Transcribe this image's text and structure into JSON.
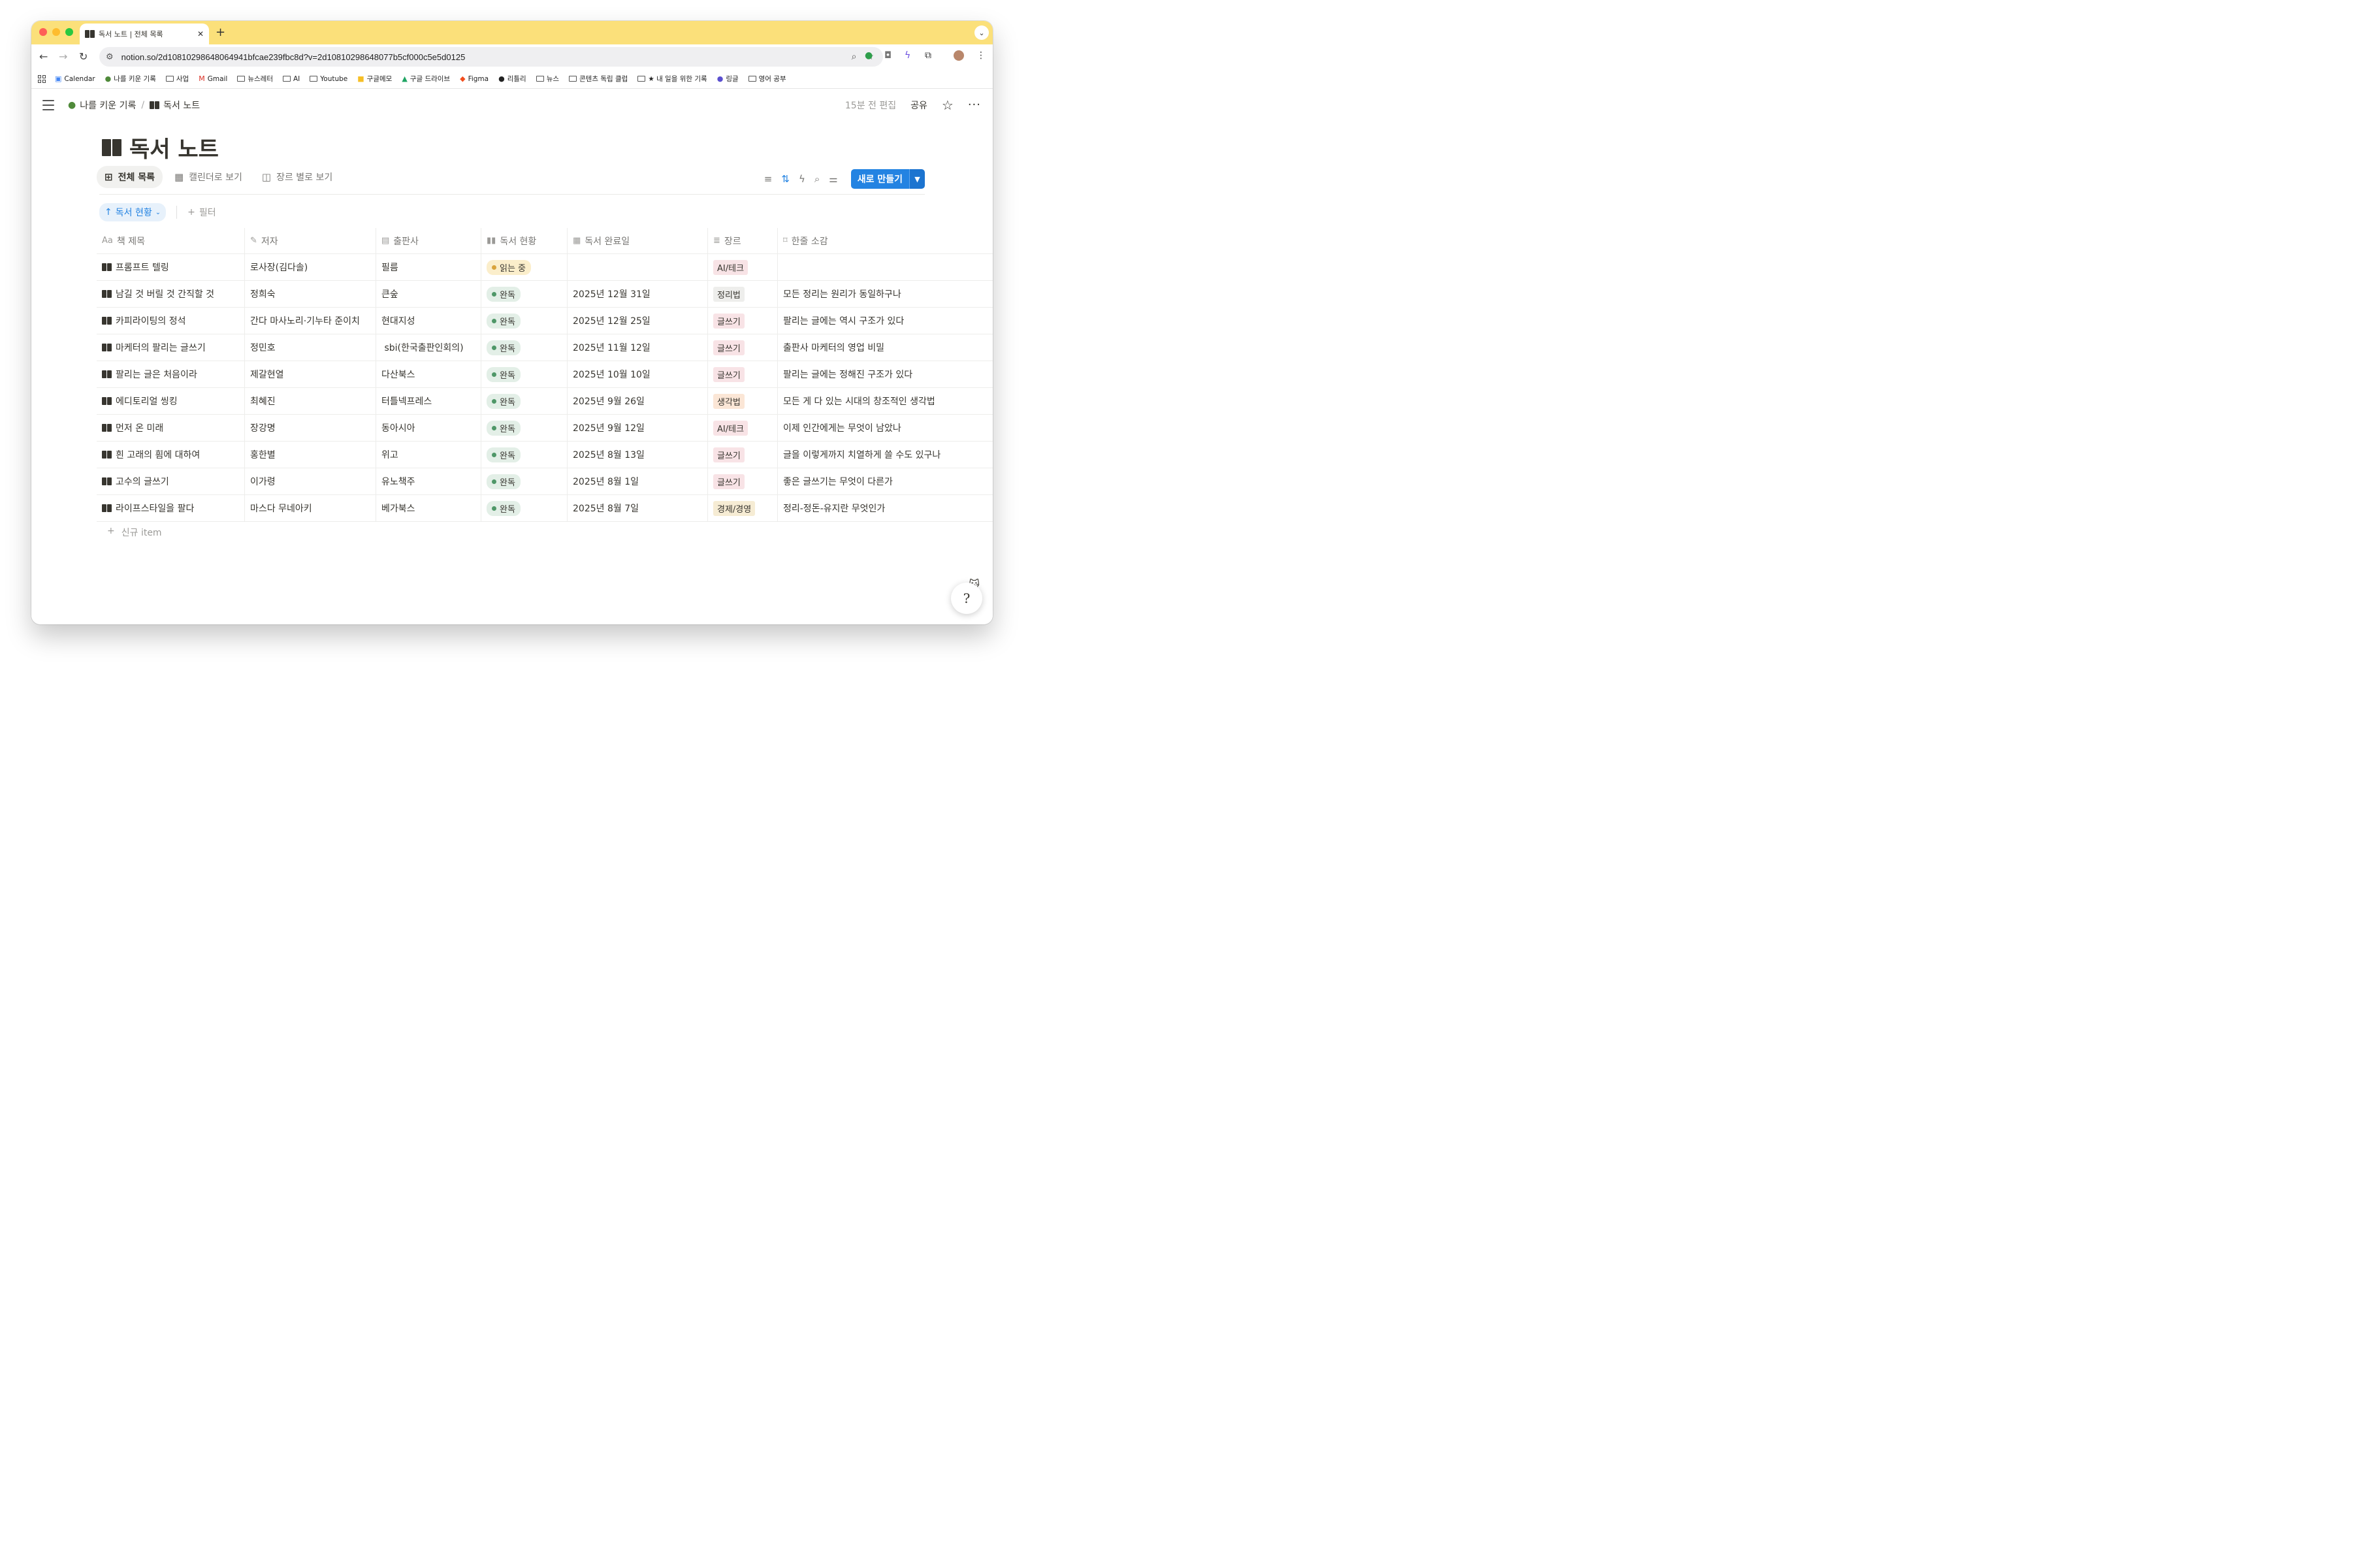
{
  "browser": {
    "tab_title": "독서 노트 | 전체 목록",
    "url": "notion.so/2d10810298648064941bfcae239fbc8d?v=2d10810298648077b5cf000c5e5d0125",
    "bookmarks": [
      {
        "label": "Calendar",
        "icon": "calendar-icon"
      },
      {
        "label": "나를 키운 기록",
        "icon": "tree-icon"
      },
      {
        "label": "사업",
        "icon": "folder-icon"
      },
      {
        "label": "Gmail",
        "icon": "gmail-icon"
      },
      {
        "label": "뉴스레터",
        "icon": "folder-icon"
      },
      {
        "label": "AI",
        "icon": "folder-icon"
      },
      {
        "label": "Youtube",
        "icon": "folder-icon"
      },
      {
        "label": "구글메모",
        "icon": "keep-icon"
      },
      {
        "label": "구글 드라이브",
        "icon": "drive-icon"
      },
      {
        "label": "Figma",
        "icon": "figma-icon"
      },
      {
        "label": "리틀리",
        "icon": "littly-icon"
      },
      {
        "label": "뉴스",
        "icon": "folder-icon"
      },
      {
        "label": "콘텐츠 독립 클럽",
        "icon": "folder-icon"
      },
      {
        "label": "★ 내 일을 위한 기록",
        "icon": "folder-icon"
      },
      {
        "label": "링글",
        "icon": "ringle-icon"
      },
      {
        "label": "영어 공부",
        "icon": "folder-icon"
      }
    ]
  },
  "page": {
    "breadcrumb_parent": "나를 키운 기록",
    "breadcrumb_current": "독서 노트",
    "edited": "15분 전 편집",
    "share": "공유",
    "title": "독서 노트",
    "views": [
      {
        "label": "전체 목록",
        "icon": "table-icon",
        "active": true
      },
      {
        "label": "캘린더로 보기",
        "icon": "calendar-icon",
        "active": false
      },
      {
        "label": "장르 별로 보기",
        "icon": "board-icon",
        "active": false
      }
    ],
    "new_button": "새로 만들기",
    "sort_chip": "독서 현황",
    "add_filter": "필터",
    "new_item": "신규 item"
  },
  "columns": [
    {
      "label": "책 제목",
      "icon": "Aa"
    },
    {
      "label": "저자",
      "icon": "✎"
    },
    {
      "label": "출판사",
      "icon": "▤"
    },
    {
      "label": "독서 현황",
      "icon": "▮▮"
    },
    {
      "label": "독서 완료일",
      "icon": "▦"
    },
    {
      "label": "장르",
      "icon": "≣"
    },
    {
      "label": "한줄 소감",
      "icon": "⌑"
    }
  ],
  "status_styles": {
    "읽는 중": {
      "bg": "#fbeecb",
      "dot": "#d9a33c",
      "color": "#37352f"
    },
    "완독": {
      "bg": "#e3efe7",
      "dot": "#4f9768",
      "color": "#37352f"
    }
  },
  "genre_styles": {
    "AI/테크": {
      "bg": "#f8e3e6",
      "color": "#37352f"
    },
    "정리법": {
      "bg": "#eeeeec",
      "color": "#37352f"
    },
    "글쓰기": {
      "bg": "#f8e3e6",
      "color": "#37352f"
    },
    "생각법": {
      "bg": "#fbe6d6",
      "color": "#37352f"
    },
    "경제/경영": {
      "bg": "#f6ecd4",
      "color": "#37352f"
    }
  },
  "rows": [
    {
      "title": "프롬프트 텔링",
      "author": "로사장(김다솔)",
      "publisher": "필름",
      "status": "읽는 중",
      "date": "",
      "genre": "AI/테크",
      "review": ""
    },
    {
      "title": "남길 것 버릴 것 간직할 것",
      "author": "정희숙",
      "publisher": "큰숲",
      "status": "완독",
      "date": "2025년 12월 31일",
      "genre": "정리법",
      "review": "모든 정리는 원리가 동일하구나"
    },
    {
      "title": "카피라이팅의 정석",
      "author": "간다 마사노리·기누타 준이치",
      "publisher": "현대지성",
      "status": "완독",
      "date": "2025년 12월 25일",
      "genre": "글쓰기",
      "review": "팔리는 글에는 역시 구조가 있다"
    },
    {
      "title": "마케터의 팔리는 글쓰기",
      "author": "정민호",
      "publisher": " sbi(한국출판인회의)",
      "status": "완독",
      "date": "2025년 11월 12일",
      "genre": "글쓰기",
      "review": "출판사 마케터의 영업 비밀"
    },
    {
      "title": "팔리는 글은 처음이라",
      "author": "제갈현열",
      "publisher": "다산북스",
      "status": "완독",
      "date": "2025년 10월 10일",
      "genre": "글쓰기",
      "review": "팔리는 글에는 정해진 구조가 있다"
    },
    {
      "title": "에디토리얼 씽킹",
      "author": "최혜진",
      "publisher": "터틀넥프레스",
      "status": "완독",
      "date": "2025년 9월 26일",
      "genre": "생각법",
      "review": "모든 게 다 있는 시대의 창조적인 생각법"
    },
    {
      "title": "먼저 온 미래",
      "author": "장강명",
      "publisher": "동아시아",
      "status": "완독",
      "date": "2025년 9월 12일",
      "genre": "AI/테크",
      "review": "이제 인간에게는 무엇이 남았나"
    },
    {
      "title": "흰 고래의 흼에 대하여",
      "author": "홍한별",
      "publisher": "위고",
      "status": "완독",
      "date": "2025년 8월 13일",
      "genre": "글쓰기",
      "review": "글을 이렇게까지 치열하게 쓸 수도 있구나"
    },
    {
      "title": "고수의 글쓰기",
      "author": "이가령",
      "publisher": "유노책주",
      "status": "완독",
      "date": "2025년 8월 1일",
      "genre": "글쓰기",
      "review": "좋은 글쓰기는 무엇이 다른가"
    },
    {
      "title": "라이프스타일을 팔다",
      "author": "마스다 무네아키",
      "publisher": "베가북스",
      "status": "완독",
      "date": "2025년 8월 7일",
      "genre": "경제/경영",
      "review": "정리-정돈-유지란 무엇인가"
    }
  ]
}
